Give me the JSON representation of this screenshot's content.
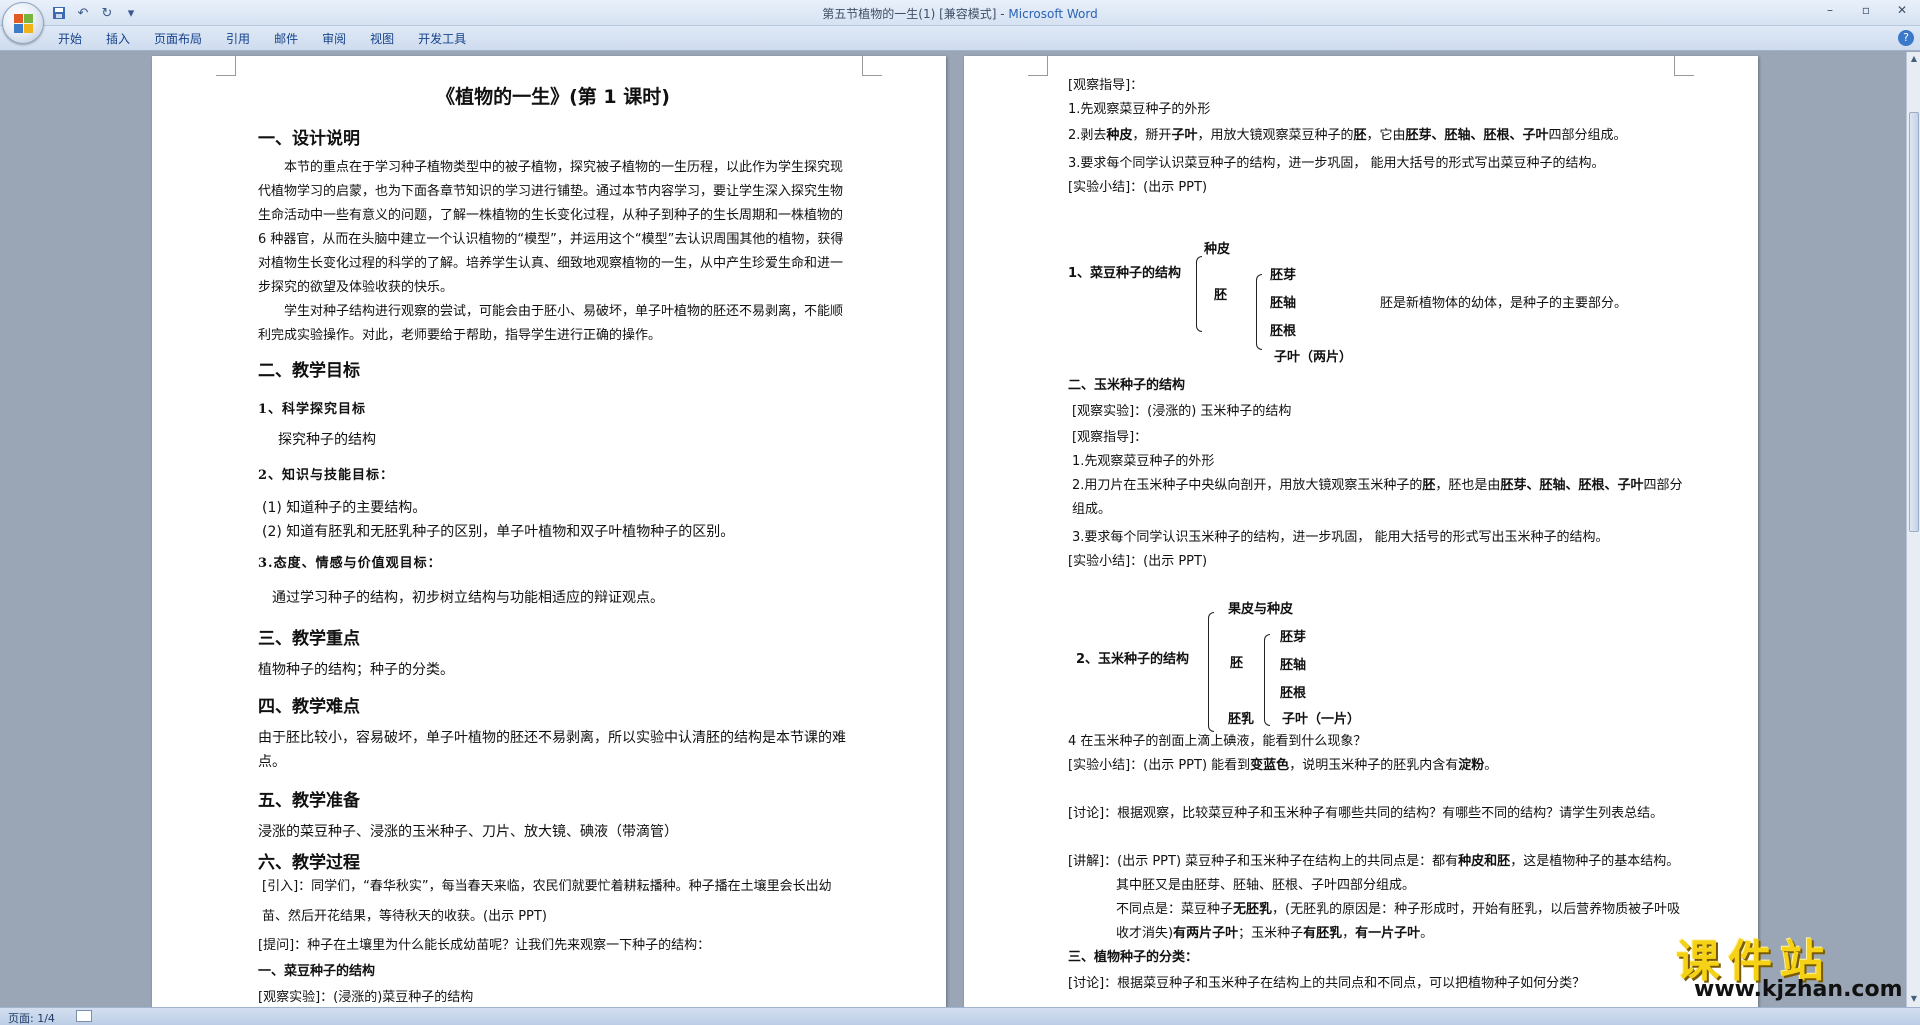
{
  "window": {
    "title_doc": "第五节植物的一生(1) [兼容模式] - ",
    "title_app": "Microsoft Word",
    "min": "–",
    "max": "▫",
    "close": "✕"
  },
  "ribbon": {
    "tabs": [
      "开始",
      "插入",
      "页面布局",
      "引用",
      "邮件",
      "审阅",
      "视图",
      "开发工具"
    ],
    "help": "?"
  },
  "page1": {
    "title": "《植物的一生》(第 1 课时)",
    "s1": "一、设计说明",
    "s1_p1": "本节的重点在于学习种子植物类型中的被子植物，探究被子植物的一生历程，以此作为学生探究现代植物学习的启蒙，也为下面各章节知识的学习进行铺垫。通过本节内容学习，要让学生深入探究生物生命活动中一些有意义的问题，了解一株植物的生长变化过程，从种子到种子的生长周期和一株植物的 6 种器官，从而在头脑中建立一个认识植物的“模型”，并运用这个“模型”去认识周围其他的植物，获得对植物生长变化过程的科学的了解。培养学生认真、细致地观察植物的一生，从中产生珍爱生命和进一步探究的欲望及体验收获的快乐。",
    "s1_p2": "学生对种子结构进行观察的尝试，可能会由于胚小、易破坏，单子叶植物的胚还不易剥离，不能顺利完成实验操作。对此，老师要给于帮助，指导学生进行正确的操作。",
    "s2": "二、教学目标",
    "s2_1": "1、科学探究目标",
    "s2_1_t": "探究种子的结构",
    "s2_2": "2、知识与技能目标：",
    "s2_2_a": "(1) 知道种子的主要结构。",
    "s2_2_b": "(2) 知道有胚乳和无胚乳种子的区别，单子叶植物和双子叶植物种子的区别。",
    "s2_3": "3.态度、情感与价值观目标：",
    "s2_3_t": "通过学习种子的结构，初步树立结构与功能相适应的辩证观点。",
    "s3": "三、教学重点",
    "s3_t": "植物种子的结构；种子的分类。",
    "s4": "四、教学难点",
    "s4_t": "由于胚比较小，容易破坏，单子叶植物的胚还不易剥离，所以实验中认清胚的结构是本节课的难点。",
    "s5": "五、教学准备",
    "s5_t": "浸涨的菜豆种子、浸涨的玉米种子、刀片、放大镜、碘液（带滴管）",
    "s6": "六、教学过程",
    "s6_intro": "[引入]：同学们，“春华秋实”，每当春天来临，农民们就要忙着耕耘播种。种子播在土壤里会长出幼苗、然后开花结果，等待秋天的收获。(出示 PPT)",
    "s6_q": "[提问]：种子在土壤里为什么能长成幼苗呢？让我们先来观察一下种子的结构：",
    "s6_sub1": "一、菜豆种子的结构",
    "s6_exp": "[观察实验]：(浸涨的)菜豆种子的结构"
  },
  "page2": {
    "guide": "[观察指导]：",
    "g1": "1.先观察菜豆种子的外形",
    "g2_pre": "2.剥去",
    "g2_b1": "种皮",
    "g2_m1": "，掰开",
    "g2_b2": "子叶",
    "g2_m2": "，用放大镜观察菜豆种子的",
    "g2_b3": "胚",
    "g2_m3": "，它由",
    "g2_b4": "胚芽、胚轴、胚根、子叶",
    "g2_end": "四部分组成。",
    "g3": "3.要求每个同学认识菜豆种子的结构，进一步巩固， 能用大括号的形式写出菜豆种子的结构。",
    "sum1": "[实验小结]：(出示 PPT)",
    "d1_label": "1、菜豆种子的结构",
    "d1_zhongpi": "种皮",
    "d1_pei": "胚",
    "d1_peiya": "胚芽",
    "d1_peizhou": "胚轴",
    "d1_peigen": "胚根",
    "d1_ziye": "子叶（两片）",
    "d1_note": "胚是新植物体的幼体，是种子的主要部分。",
    "s2": "二、玉米种子的结构",
    "exp2": "[观察实验]：(浸涨的) 玉米种子的结构",
    "guide2": "[观察指导]：",
    "h1": "1.先观察菜豆种子的外形",
    "h2_pre": "2.用刀片在玉米种子中央纵向剖开，用放大镜观察玉米种子的",
    "h2_b1": "胚",
    "h2_m1": "，胚也是由",
    "h2_b2": "胚芽、胚轴、胚根、子叶",
    "h2_end": "四部分组成。",
    "h3": "3.要求每个同学认识玉米种子的结构，进一步巩固， 能用大括号的形式写出玉米种子的结构。",
    "sum2": "[实验小结]：(出示 PPT)",
    "d2_label": "2、玉米种子的结构",
    "d2_guopi": "果皮与种皮",
    "d2_pei": "胚",
    "d2_peiya": "胚芽",
    "d2_peizhou": "胚轴",
    "d2_peigen": "胚根",
    "d2_peiru": "胚乳",
    "d2_ziye": "子叶（一片）",
    "i4": "4 在玉米种子的剖面上滴上碘液，能看到什么现象？",
    "sum3_pre": "[实验小结]：(出示 PPT) 能看到",
    "sum3_b1": "变蓝色",
    "sum3_m": "，说明玉米种子的胚乳内含有",
    "sum3_b2": "淀粉",
    "sum3_end": "。",
    "disc": "[讨论]：根据观察，比较菜豆种子和玉米种子有哪些共同的结构？有哪些不同的结构？请学生列表总结。",
    "lec_pre": "[讲解]：(出示 PPT) 菜豆种子和玉米种子在结构上的共同点是：都有",
    "lec_b1": "种皮和胚",
    "lec_end": "，这是植物种子的基本结构。其中胚又是由胚芽、胚轴、胚根、子叶四部分组成。",
    "diff_pre": "不同点是：菜豆种子",
    "diff_b1": "无胚乳",
    "diff_m1": "，(无胚乳的原因是：种子形成时，开始有胚乳，以后营养物质被子叶吸收才消失)",
    "diff_b2": "有两片子叶",
    "diff_m2": "；玉米种子",
    "diff_b3": "有胚乳",
    "diff_m3": "，",
    "diff_b4": "有一片子叶",
    "diff_end": "。",
    "s3": "三、植物种子的分类：",
    "disc2": "[讨论]：根据菜豆种子和玉米种子在结构上的共同点和不同点，可以把植物种子如何分类？"
  },
  "status": {
    "page": "页面: 1/4"
  },
  "watermark": {
    "title": "课件站",
    "url": "www.kjzhan.com"
  },
  "colors": {
    "ribbon_text": "#15428b",
    "watermark_yellow": "#f5d215"
  }
}
